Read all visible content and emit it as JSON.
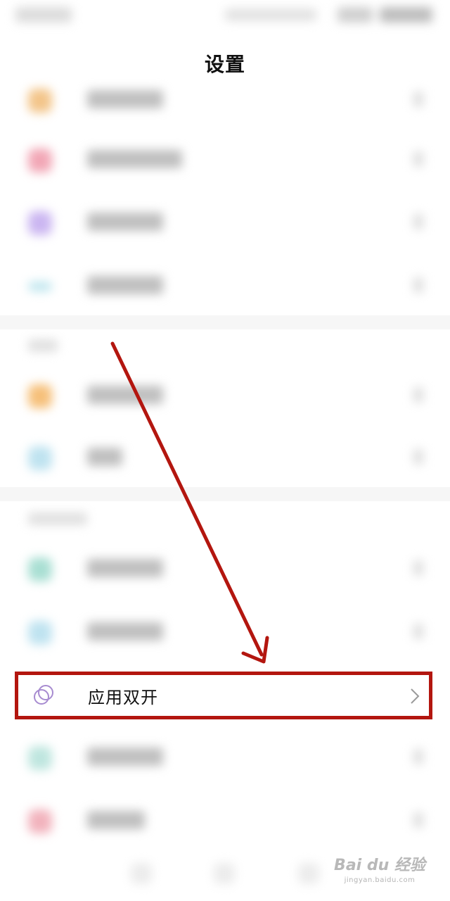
{
  "header": {
    "title": "设置"
  },
  "highlighted_item": {
    "label": "应用双开",
    "icon": "dual-circles-icon"
  },
  "watermark": {
    "brand": "Bai du 经验",
    "url": "jingyan.baidu.com"
  },
  "colors": {
    "highlight": "#b3160f",
    "arrow": "#b3160f",
    "icon_purple": "#a78bd0"
  }
}
